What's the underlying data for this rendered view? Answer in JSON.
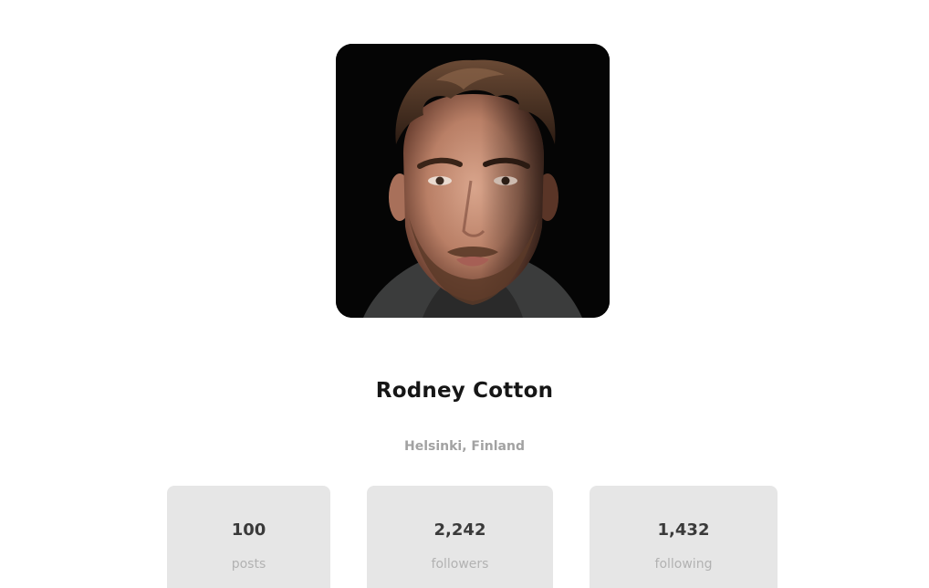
{
  "profile": {
    "name": "Rodney Cotton",
    "location": "Helsinki, Finland"
  },
  "stats": [
    {
      "value": "100",
      "label": "posts"
    },
    {
      "value": "2,242",
      "label": "followers"
    },
    {
      "value": "1,432",
      "label": "following"
    }
  ],
  "colors": {
    "card_background": "#e6e6e6",
    "name_text": "#161616",
    "muted_text": "#a2a2a2"
  }
}
